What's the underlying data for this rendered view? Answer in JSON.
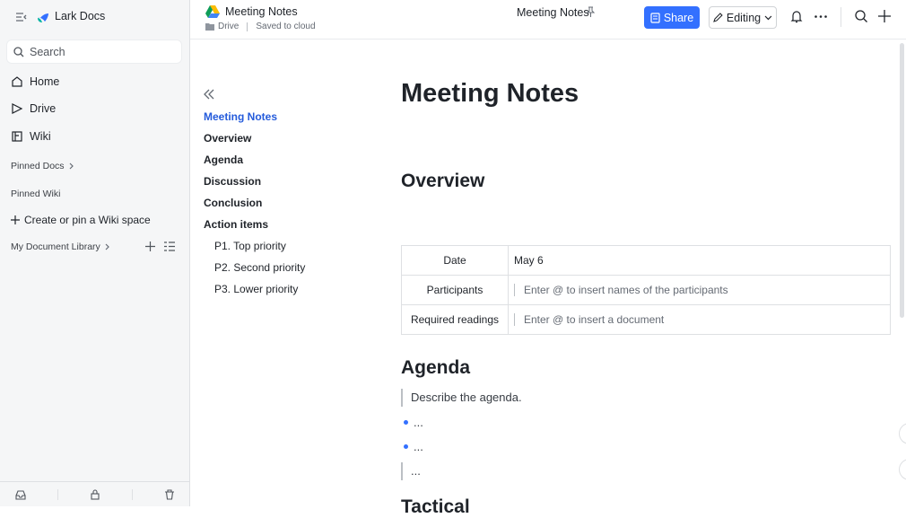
{
  "sidebar": {
    "app_name": "Lark Docs",
    "search_placeholder": "Search",
    "nav": [
      {
        "label": "Home",
        "icon": "home-icon"
      },
      {
        "label": "Drive",
        "icon": "drive-icon"
      },
      {
        "label": "Wiki",
        "icon": "wiki-icon"
      }
    ],
    "pinned_docs": "Pinned Docs",
    "pinned_wiki": "Pinned Wiki",
    "create_wiki": "Create or pin a Wiki space",
    "doc_library": "My Document Library",
    "bottom_icons": [
      "inbox-icon",
      "lock-icon",
      "trash-icon"
    ]
  },
  "topbar": {
    "doc_title": "Meeting Notes",
    "location": "Drive",
    "save_status": "Saved to cloud",
    "center_title": "Meeting Notes",
    "share_label": "Share",
    "mode_label": "Editing"
  },
  "toc": {
    "items": [
      "Meeting Notes",
      "Overview",
      "Agenda",
      "Discussion",
      "Conclusion",
      "Action items"
    ],
    "sub_items": [
      "P1. Top priority",
      "P2. Second priority",
      "P3. Lower priority"
    ]
  },
  "doc": {
    "title": "Meeting Notes",
    "overview_heading": "Overview",
    "table": [
      {
        "label": "Date",
        "value": "May 6"
      },
      {
        "label": "Participants",
        "value": "Enter @ to insert names of the participants"
      },
      {
        "label": "Required readings",
        "value": "Enter @ to insert a document"
      }
    ],
    "agenda_heading": "Agenda",
    "agenda_desc": "Describe the agenda.",
    "bullets": [
      "...",
      "..."
    ],
    "quote_end": "...",
    "next_heading": "Tactical"
  },
  "colors": {
    "accent": "#3370ff",
    "toc_active": "#245bdb"
  }
}
